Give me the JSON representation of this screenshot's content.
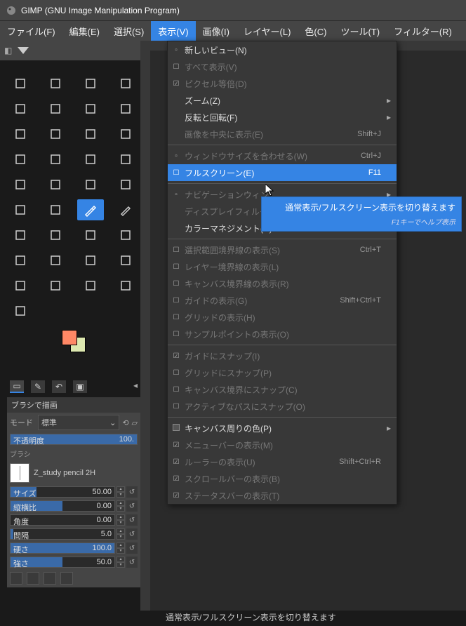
{
  "app": {
    "title": "GIMP (GNU Image Manipulation Program)"
  },
  "menubar": [
    {
      "label": "ファイル(F)"
    },
    {
      "label": "編集(E)"
    },
    {
      "label": "選択(S)"
    },
    {
      "label": "表示(V)",
      "active": true
    },
    {
      "label": "画像(I)"
    },
    {
      "label": "レイヤー(L)"
    },
    {
      "label": "色(C)"
    },
    {
      "label": "ツール(T)"
    },
    {
      "label": "フィルター(R)"
    }
  ],
  "view_menu": [
    {
      "type": "item",
      "label": "新しいビュー(N)",
      "icon": "copy"
    },
    {
      "type": "check",
      "label": "すべて表示(V)",
      "checked": false,
      "disabled": true
    },
    {
      "type": "check",
      "label": "ピクセル等倍(D)",
      "checked": true,
      "disabled": true
    },
    {
      "type": "sub",
      "label": "ズーム(Z)"
    },
    {
      "type": "sub",
      "label": "反転と回転(F)"
    },
    {
      "type": "item",
      "label": "画像を中央に表示(E)",
      "accel": "Shift+J",
      "disabled": true
    },
    {
      "type": "sep"
    },
    {
      "type": "item",
      "label": "ウィンドウサイズを合わせる(W)",
      "accel": "Ctrl+J",
      "disabled": true,
      "icon": "fit"
    },
    {
      "type": "check",
      "label": "フルスクリーン(E)",
      "accel": "F11",
      "checked": false,
      "highlighted": true
    },
    {
      "type": "sep"
    },
    {
      "type": "sub",
      "label": "ナビゲーションウィン",
      "disabled": true,
      "icon": "nav"
    },
    {
      "type": "sub",
      "label": "ディスプレイフィルタ",
      "disabled": true
    },
    {
      "type": "sub",
      "label": "カラーマネジメント(C)"
    },
    {
      "type": "sep"
    },
    {
      "type": "check",
      "label": "選択範囲境界線の表示(S)",
      "accel": "Ctrl+T",
      "disabled": true
    },
    {
      "type": "check",
      "label": "レイヤー境界線の表示(L)",
      "disabled": true
    },
    {
      "type": "check",
      "label": "キャンバス境界線の表示(R)",
      "disabled": true
    },
    {
      "type": "check",
      "label": "ガイドの表示(G)",
      "accel": "Shift+Ctrl+T",
      "disabled": true
    },
    {
      "type": "check",
      "label": "グリッドの表示(H)",
      "disabled": true
    },
    {
      "type": "check",
      "label": "サンプルポイントの表示(O)",
      "disabled": true
    },
    {
      "type": "sep"
    },
    {
      "type": "check",
      "label": "ガイドにスナップ(I)",
      "checked": true,
      "disabled": true
    },
    {
      "type": "check",
      "label": "グリッドにスナップ(P)",
      "disabled": true
    },
    {
      "type": "check",
      "label": "キャンバス境界にスナップ(C)",
      "disabled": true
    },
    {
      "type": "check",
      "label": "アクティブなパスにスナップ(O)",
      "disabled": true
    },
    {
      "type": "sep"
    },
    {
      "type": "sub",
      "label": "キャンバス周りの色(P)",
      "icon": "swatch"
    },
    {
      "type": "check",
      "label": "メニューバーの表示(M)",
      "checked": true,
      "disabled": true
    },
    {
      "type": "check",
      "label": "ルーラーの表示(U)",
      "accel": "Shift+Ctrl+R",
      "checked": true,
      "disabled": true
    },
    {
      "type": "check",
      "label": "スクロールバーの表示(B)",
      "checked": true,
      "disabled": true
    },
    {
      "type": "check",
      "label": "ステータスバーの表示(T)",
      "checked": true,
      "disabled": true
    }
  ],
  "tooltip": {
    "main": "通常表示/フルスクリーン表示を切り替えます",
    "sub": "F1キーでヘルプ表示"
  },
  "statusbar": {
    "text": "通常表示/フルスクリーン表示を切り替えます"
  },
  "tooloptions": {
    "header": "ブラシで描画",
    "mode_label": "モード",
    "mode_value": "標準",
    "opacity_label": "不透明度",
    "opacity_value": "100.",
    "brush_label": "ブラシ",
    "brush_name": "Z_study pencil 2H",
    "sliders": [
      {
        "label": "サイズ",
        "value": "50.00",
        "fill": 25
      },
      {
        "label": "縦横比",
        "value": "0.00",
        "fill": 50
      },
      {
        "label": "角度",
        "value": "0.00",
        "fill": 0
      },
      {
        "label": "間隔",
        "value": "5.0",
        "fill": 3
      },
      {
        "label": "硬さ",
        "value": "100.0",
        "fill": 100
      },
      {
        "label": "強さ",
        "value": "50.0",
        "fill": 50
      }
    ]
  },
  "colors": {
    "fg": "#ff8866",
    "bg": "#dde8b0"
  }
}
